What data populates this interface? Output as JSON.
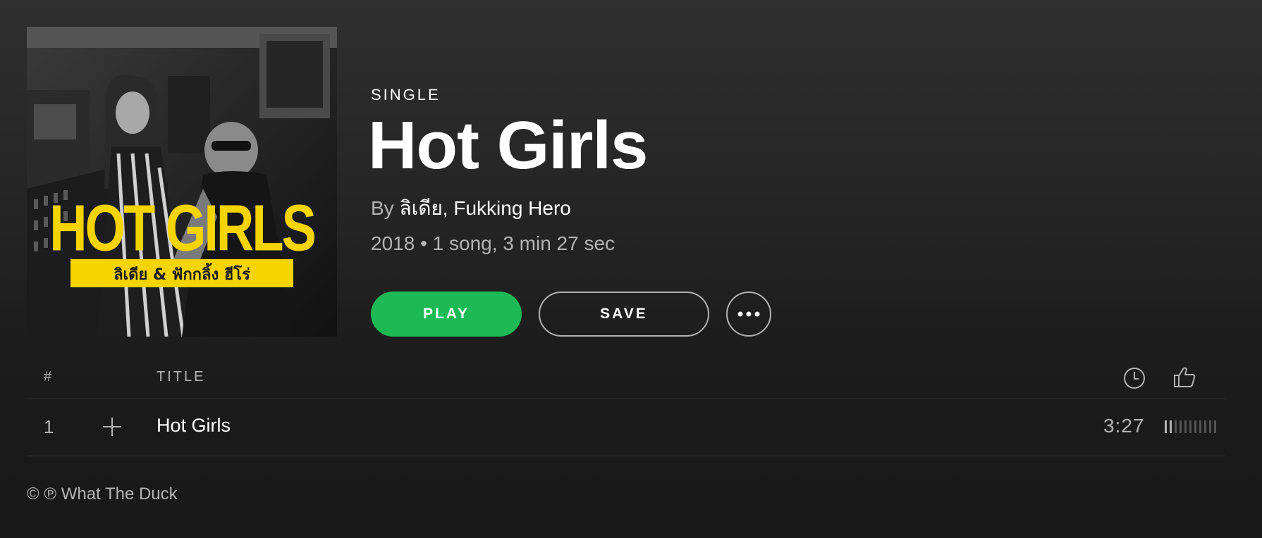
{
  "album": {
    "type_label": "SINGLE",
    "title": "Hot Girls",
    "by_prefix": "By ",
    "artists": [
      "ลิเดีย",
      "Fukking Hero"
    ],
    "artist_separator": ", ",
    "year": "2018",
    "meta_separator": " • ",
    "summary": "1 song, 3 min 27 sec",
    "cover": {
      "title_text": "HOT GIRLS",
      "subtitle_text": "ลิเดีย & ฟักกลิ้ง ฮีโร่",
      "accent_color": "#f5d400"
    }
  },
  "actions": {
    "play_label": "PLAY",
    "save_label": "SAVE",
    "more_icon": "more-horizontal-icon",
    "play_color": "#1db954"
  },
  "tracklist": {
    "headers": {
      "number": "#",
      "title": "TITLE",
      "duration_icon": "clock-icon",
      "like_icon": "thumbs-up-icon"
    },
    "rows": [
      {
        "number": "1",
        "add_icon": "plus-icon",
        "title": "Hot Girls",
        "duration": "3:27",
        "popularity": 0.2
      }
    ]
  },
  "footer": {
    "copyright": "© ℗ What The Duck"
  }
}
